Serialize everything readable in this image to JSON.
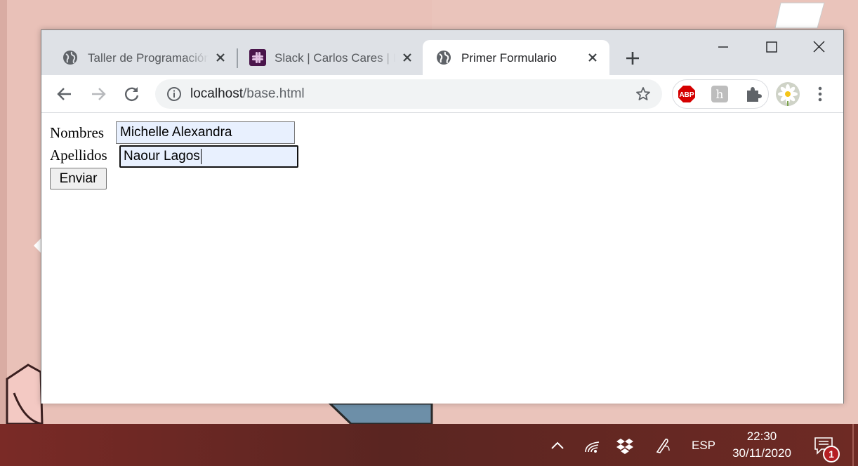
{
  "browser": {
    "tabs": [
      {
        "title": "Taller de Programación",
        "icon": "globe-icon",
        "active": false
      },
      {
        "title": "Slack | Carlos Cares | Ingeniería",
        "icon": "slack-icon",
        "active": false
      },
      {
        "title": "Primer Formulario",
        "icon": "globe-icon",
        "active": true
      }
    ],
    "address": {
      "host": "localhost",
      "path": "/base.html"
    },
    "extensions": [
      "adblock-plus-icon",
      "h-extension-icon",
      "puzzle-icon"
    ]
  },
  "form": {
    "nombres_label": "Nombres",
    "nombres_value": "Michelle Alexandra",
    "apellidos_label": "Apellidos",
    "apellidos_value": "Naour Lagos",
    "submit_label": "Enviar"
  },
  "taskbar": {
    "language": "ESP",
    "time": "22:30",
    "date": "30/11/2020",
    "notification_count": "1"
  },
  "colors": {
    "taskbar": "#5a2521",
    "wallpaper": "#e9c1b8",
    "input_autofill": "#e8f0fe"
  }
}
